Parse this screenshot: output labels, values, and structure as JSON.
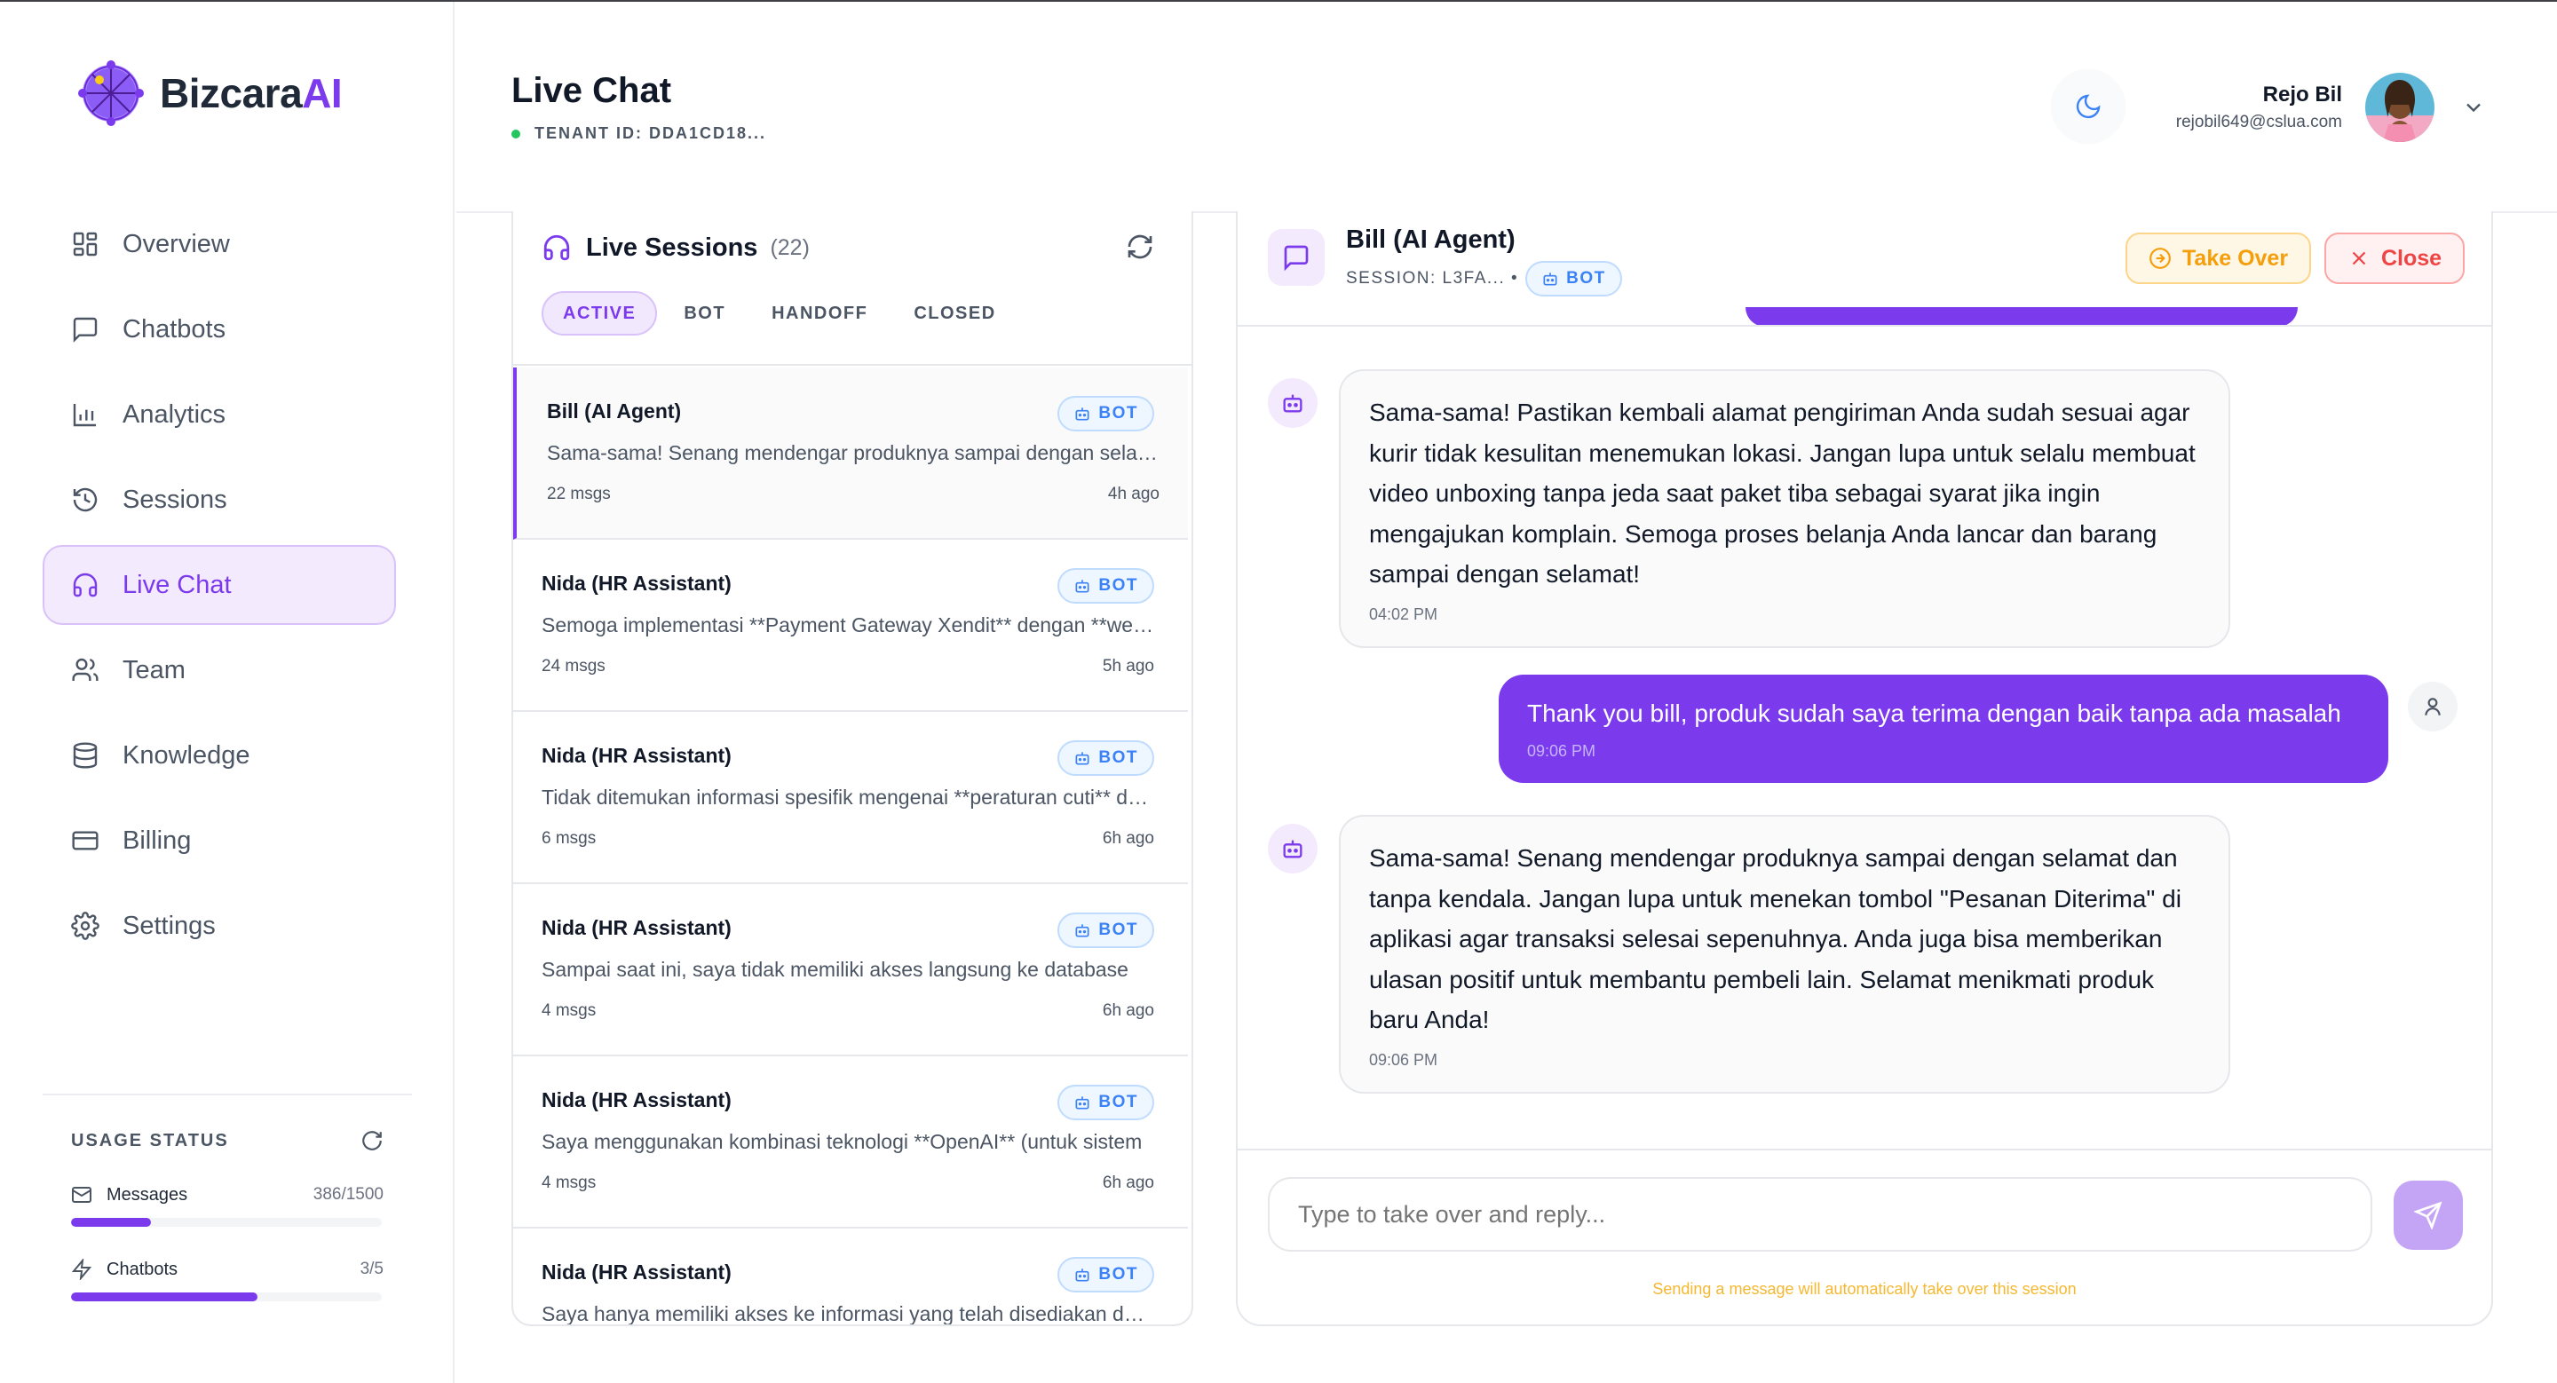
{
  "brand": {
    "name_main": "Bizcara",
    "name_accent": "AI"
  },
  "sidebar": {
    "items": [
      {
        "label": "Overview",
        "icon": "grid-icon"
      },
      {
        "label": "Chatbots",
        "icon": "message-square-icon"
      },
      {
        "label": "Analytics",
        "icon": "bar-chart-icon"
      },
      {
        "label": "Sessions",
        "icon": "history-icon"
      },
      {
        "label": "Live Chat",
        "icon": "headset-icon",
        "active": true
      },
      {
        "label": "Team",
        "icon": "users-icon"
      },
      {
        "label": "Knowledge",
        "icon": "database-icon"
      },
      {
        "label": "Billing",
        "icon": "credit-card-icon"
      },
      {
        "label": "Settings",
        "icon": "gear-icon"
      }
    ],
    "usage": {
      "title": "USAGE STATUS",
      "messages": {
        "label": "Messages",
        "count": "386/1500",
        "fraction": 0.2573
      },
      "chatbots": {
        "label": "Chatbots",
        "count": "3/5",
        "fraction": 0.6
      }
    }
  },
  "header": {
    "title": "Live Chat",
    "tenant": "TENANT ID: DDA1CD18...",
    "user": {
      "name": "Rejo Bil",
      "email": "rejobil649@cslua.com"
    }
  },
  "sessions": {
    "title": "Live Sessions",
    "count": "(22)",
    "filters": [
      "ACTIVE",
      "BOT",
      "HANDOFF",
      "CLOSED"
    ],
    "active_filter": "ACTIVE",
    "badge_label": "BOT",
    "items": [
      {
        "name": "Bill (AI Agent)",
        "snippet": "Sama-sama! Senang mendengar produknya sampai dengan selamat dan tanpa kendala.",
        "msgs": "22 msgs",
        "time": "4h ago",
        "selected": true
      },
      {
        "name": "Nida (HR Assistant)",
        "snippet": "Semoga implementasi **Payment Gateway Xendit** dengan **webhook**",
        "msgs": "24 msgs",
        "time": "5h ago"
      },
      {
        "name": "Nida (HR Assistant)",
        "snippet": "Tidak ditemukan informasi spesifik mengenai **peraturan cuti** dalam",
        "msgs": "6 msgs",
        "time": "6h ago"
      },
      {
        "name": "Nida (HR Assistant)",
        "snippet": "Sampai saat ini, saya tidak memiliki akses langsung ke database",
        "msgs": "4 msgs",
        "time": "6h ago"
      },
      {
        "name": "Nida (HR Assistant)",
        "snippet": "Saya menggunakan kombinasi teknologi **OpenAI** (untuk sistem",
        "msgs": "4 msgs",
        "time": "6h ago"
      },
      {
        "name": "Nida (HR Assistant)",
        "snippet": "Saya hanya memiliki akses ke informasi yang telah disediakan dalam",
        "msgs": "",
        "time": ""
      }
    ]
  },
  "chat": {
    "agent_name": "Bill (AI Agent)",
    "session_label": "SESSION: L3FA... •",
    "badge_label": "BOT",
    "take_over_label": "Take Over",
    "close_label": "Close",
    "messages": [
      {
        "role": "bot",
        "text": "Sama-sama! Pastikan kembali alamat pengiriman Anda sudah sesuai agar kurir tidak kesulitan menemukan lokasi. Jangan lupa untuk selalu membuat video unboxing tanpa jeda saat paket tiba sebagai syarat jika ingin mengajukan komplain. Semoga proses belanja Anda lancar dan barang sampai dengan selamat!",
        "time": "04:02 PM"
      },
      {
        "role": "user",
        "text": "Thank you bill, produk sudah saya terima dengan baik tanpa ada masalah",
        "time": "09:06 PM"
      },
      {
        "role": "bot",
        "text": "Sama-sama! Senang mendengar produknya sampai dengan selamat dan tanpa kendala. Jangan lupa untuk menekan tombol \"Pesanan Diterima\" di aplikasi agar transaksi selesai sepenuhnya. Anda juga bisa memberikan ulasan positif untuk membantu pembeli lain. Selamat menikmati produk baru Anda!",
        "time": "09:06 PM"
      }
    ],
    "input_placeholder": "Type to take over and reply...",
    "hint": "Sending a message will automatically take over this session"
  },
  "colors": {
    "accent": "#7c3aed",
    "bot_badge": "#3b82f6",
    "take_over": "#f59e0b",
    "close": "#ef4444",
    "online": "#22c55e"
  }
}
